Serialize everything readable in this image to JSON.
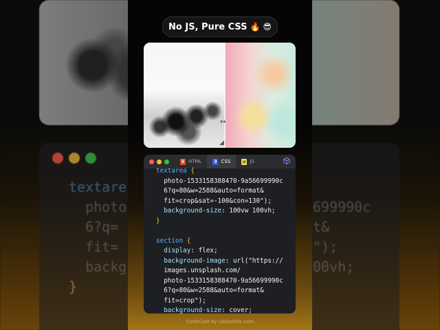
{
  "header": {
    "title": "No JS, Pure CSS",
    "emoji_1": "🔥",
    "emoji_2": "😎"
  },
  "editor": {
    "tabs": [
      {
        "label": "HTML",
        "icon": "html5-icon",
        "color": "#e44d26"
      },
      {
        "label": "CSS",
        "icon": "css3-icon",
        "color": "#2965f1"
      },
      {
        "label": "JS",
        "icon": "js-icon",
        "color": "#f0db4f"
      }
    ],
    "active_tab": "CSS",
    "window_dots": [
      "#ff5f57",
      "#febc2e",
      "#28c840"
    ],
    "code_lines": [
      {
        "parts": [
          {
            "t": "textarea",
            "c": "sel"
          },
          {
            "t": " {",
            "c": "brace"
          }
        ]
      },
      {
        "parts": [
          {
            "t": "  photo-1533158388470-9a56699990c",
            "c": "str"
          }
        ]
      },
      {
        "parts": [
          {
            "t": "  6?q=80&w=2588&auto=format&",
            "c": "str"
          }
        ]
      },
      {
        "parts": [
          {
            "t": "  fit=crop&sat=-100&con=130\");",
            "c": "str"
          }
        ]
      },
      {
        "parts": [
          {
            "t": "  background-size",
            "c": "prop"
          },
          {
            "t": ": 100vw 100vh;",
            "c": "str"
          }
        ]
      },
      {
        "parts": [
          {
            "t": "}",
            "c": "brace"
          }
        ]
      },
      {
        "parts": [
          {
            "t": "",
            "c": "str"
          }
        ]
      },
      {
        "parts": [
          {
            "t": "section",
            "c": "sel"
          },
          {
            "t": " {",
            "c": "brace"
          }
        ]
      },
      {
        "parts": [
          {
            "t": "  display",
            "c": "prop"
          },
          {
            "t": ": flex;",
            "c": "str"
          }
        ]
      },
      {
        "parts": [
          {
            "t": "  background-image",
            "c": "prop"
          },
          {
            "t": ": url(\"https://",
            "c": "str"
          }
        ]
      },
      {
        "parts": [
          {
            "t": "  images.unsplash.com/",
            "c": "str"
          }
        ]
      },
      {
        "parts": [
          {
            "t": "  photo-1533158388470-9a56699990c",
            "c": "str"
          }
        ]
      },
      {
        "parts": [
          {
            "t": "  6?q=80&w=2588&auto=format&",
            "c": "str"
          }
        ]
      },
      {
        "parts": [
          {
            "t": "  fit=crop\");",
            "c": "str"
          }
        ]
      },
      {
        "parts": [
          {
            "t": "  background-size",
            "c": "prop"
          },
          {
            "t": ": cover;",
            "c": "str"
          }
        ]
      }
    ]
  },
  "footer": {
    "credit": "CodeCast by uiblocbits.com"
  },
  "backdrop_code": [
    "textare",
    "  photo",
    "  6?q=",
    "  fit=",
    "  backg",
    "}"
  ],
  "backdrop_code_right": [
    "699990c",
    "t&",
    "\");",
    "00vh;"
  ]
}
